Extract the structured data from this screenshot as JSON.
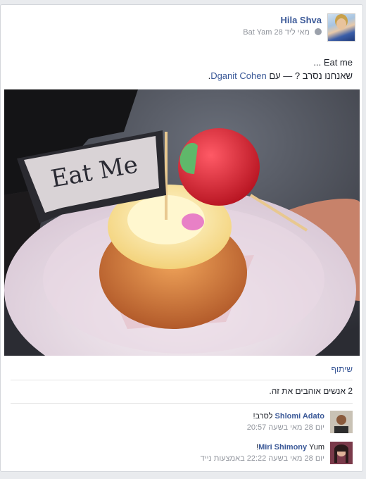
{
  "post": {
    "author": "Hila Shva",
    "date": "28 מאי ליד",
    "location": "Bat Yam",
    "text_line1": "Eat me ...",
    "text_line2_prefix": "שאנחנו נסרב ? — עם",
    "tagged": "Dganit Cohen",
    "photo_flag_text": "Eat Me"
  },
  "actions": {
    "share": "שיתוף"
  },
  "likes": "2 אנשים אוהבים את זה.",
  "comments": [
    {
      "name": "Shlomi Adato",
      "text": "לסרב!",
      "time": "יום 28 מאי בשעה 20:57"
    },
    {
      "name": "Miri Shimony",
      "text": "Yum!",
      "time": "יום 28 מאי בשעה 22:22 באמצעות נייד"
    }
  ]
}
